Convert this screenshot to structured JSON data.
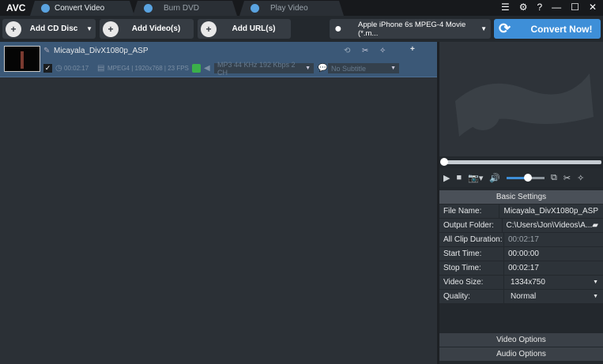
{
  "app": {
    "logo": "AVC"
  },
  "tabs": [
    {
      "label": "Convert Video"
    },
    {
      "label": "Burn DVD"
    },
    {
      "label": "Play Video"
    }
  ],
  "window_controls": {
    "log": "☰",
    "settings": "⚙",
    "help": "?",
    "minimize": "—",
    "maximize": "☐",
    "close": "✕"
  },
  "toolbar": {
    "add_cd": "Add CD Disc",
    "add_video": "Add Video(s)",
    "add_url": "Add URL(s)",
    "profile": "Apple iPhone 6s MPEG-4 Movie (*.m...",
    "convert": "Convert Now!"
  },
  "file": {
    "name": "Micayala_DivX1080p_ASP",
    "duration": "00:02:17",
    "video_info": "MPEG4 | 1920x768 | 23 FPS",
    "audio": "MP3 44 KHz 192 Kbps 2 CH",
    "subtitle": "No Subtitle"
  },
  "player": {
    "seek_progress": 0,
    "volume": 0.55
  },
  "settings": {
    "header": "Basic Settings",
    "rows": [
      {
        "key": "File Name:",
        "value": "Micayala_DivX1080p_ASP"
      },
      {
        "key": "Output Folder:",
        "value": "C:\\Users\\Jon\\Videos\\A..."
      },
      {
        "key": "All Clip Duration:",
        "value": "00:02:17"
      },
      {
        "key": "Start Time:",
        "value": "00:00:00"
      },
      {
        "key": "Stop Time:",
        "value": "00:02:17"
      },
      {
        "key": "Video Size:",
        "value": "1334x750"
      },
      {
        "key": "Quality:",
        "value": "Normal"
      }
    ],
    "video_options": "Video Options",
    "audio_options": "Audio Options"
  }
}
